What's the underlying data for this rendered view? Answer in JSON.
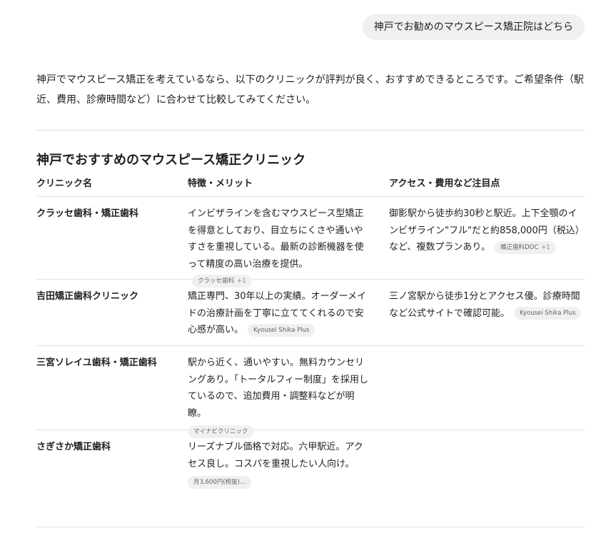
{
  "user_message": "神戸でお勧めのマウスピース矯正院はどちら",
  "intro": "神戸でマウスピース矯正を考えているなら、以下のクリニックが評判が良く、おすすめできるところです。ご希望条件（駅近、費用、診療時間など）に合わせて比較してみてください。",
  "section_title": "神戸でおすすめのマウスピース矯正クリニック",
  "table": {
    "headers": [
      "クリニック名",
      "特徴・メリット",
      "アクセス・費用など注目点"
    ],
    "rows": [
      {
        "name": "クラッセ歯科・矯正歯科",
        "features": "インビザラインを含むマウスピース型矯正を得意としており、目立ちにくさや通いやすさを重視している。最新の診断機器を使って精度の高い治療を提供。",
        "features_source": {
          "label": "クラッセ歯科",
          "more": "+1"
        },
        "access": "御影駅から徒歩約30秒と駅近。上下全顎のインビザライン\"フル\"だと約858,000円（税込）など、複数プランあり。",
        "access_source": {
          "label": "矯正歯科DOC",
          "more": "+1"
        }
      },
      {
        "name": "吉田矯正歯科クリニック",
        "features": "矯正専門、30年以上の実績。オーダーメイドの治療計画を丁寧に立ててくれるので安心感が高い。",
        "features_source": {
          "label": "Kyousei Shika Plus",
          "more": ""
        },
        "access": "三ノ宮駅から徒歩1分とアクセス優。診療時間など公式サイトで確認可能。",
        "access_source": {
          "label": "Kyousei Shika Plus",
          "more": ""
        }
      },
      {
        "name": "三宮ソレイユ歯科・矯正歯科",
        "features": "駅から近く、通いやすい。無料カウンセリングあり。「トータルフィー制度」を採用しているので、追加費用・調整料などが明瞭。",
        "features_source": {
          "label": "マイナビクリニック",
          "more": ""
        },
        "access": "",
        "access_source": null
      },
      {
        "name": "さぎさか矯正歯科",
        "features": "リーズナブル価格で対応。六甲駅近。アクセス良し。コスパを重視したい人向け。",
        "features_source": {
          "label": "月3,600円(税抜)...",
          "more": ""
        },
        "access": "",
        "access_source": null
      }
    ]
  }
}
